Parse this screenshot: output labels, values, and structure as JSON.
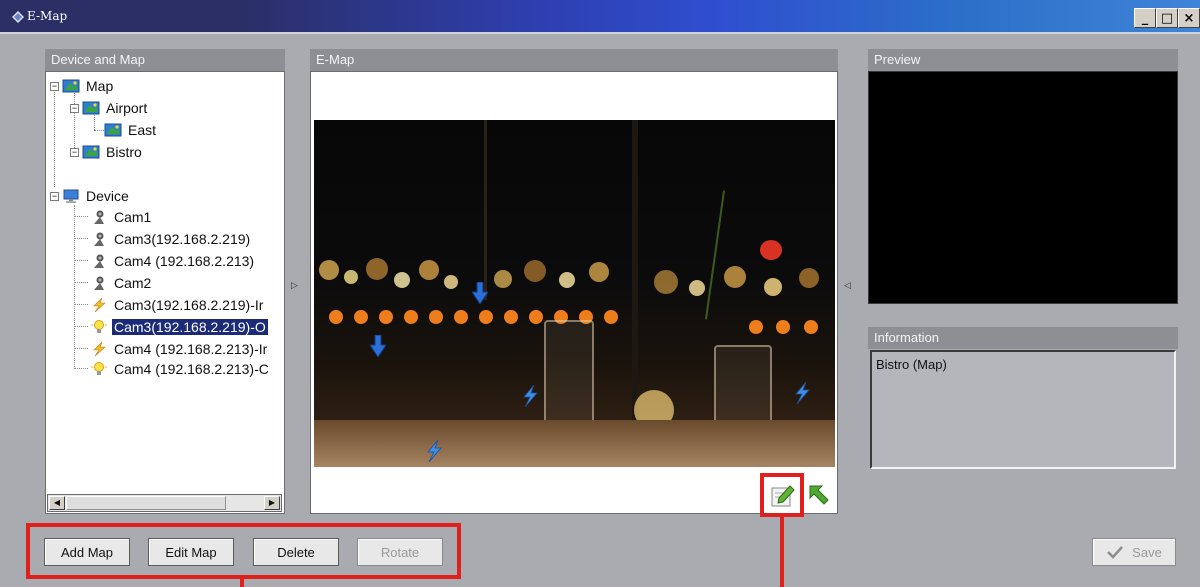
{
  "window": {
    "title": "E-Map",
    "controls": [
      "_",
      "□",
      "×"
    ]
  },
  "panels": {
    "device_and_map": {
      "title": "Device and Map"
    },
    "emap": {
      "title": "E-Map"
    },
    "preview": {
      "title": "Preview"
    },
    "information": {
      "title": "Information",
      "text": "Bistro (Map)"
    }
  },
  "tree": {
    "map_root": "Map",
    "maps": [
      {
        "label": "Airport",
        "children": [
          "East"
        ]
      },
      {
        "label": "Bistro"
      }
    ],
    "device_root": "Device",
    "devices": [
      {
        "label": "Cam1",
        "type": "camera"
      },
      {
        "label": "Cam3(192.168.2.219)",
        "type": "camera"
      },
      {
        "label": "Cam4 (192.168.2.213)",
        "type": "camera"
      },
      {
        "label": "Cam2",
        "type": "camera"
      },
      {
        "label": "Cam3(192.168.2.219)-Ir",
        "type": "input"
      },
      {
        "label": "Cam3(192.168.2.219)-O",
        "type": "output",
        "selected": true
      },
      {
        "label": "Cam4 (192.168.2.213)-Ir",
        "type": "input"
      },
      {
        "label": "Cam4 (192.168.2.213)-C",
        "type": "output"
      }
    ]
  },
  "buttons": {
    "add_map": "Add Map",
    "edit_map": "Edit Map",
    "delete": "Delete",
    "rotate": "Rotate",
    "save": "Save"
  },
  "emap_tools": [
    "edit-icon",
    "back-arrow-icon"
  ],
  "colors": {
    "selection": "#1c2b78",
    "highlight": "#e0201c",
    "panel_header": "#8d8f95"
  }
}
